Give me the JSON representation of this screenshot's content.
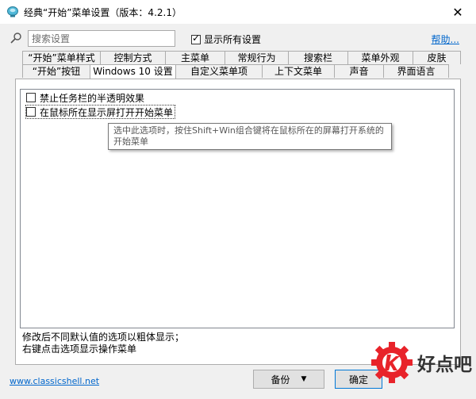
{
  "window": {
    "title": "经典“开始”菜单设置（版本：4.2.1）",
    "close_glyph": "✕"
  },
  "toolbar": {
    "search_placeholder": "搜索设置",
    "show_all_label": "显示所有设置",
    "show_all_checked": true,
    "help_label": "帮助..."
  },
  "tabs": {
    "row1": [
      "“开始”菜单样式",
      "控制方式",
      "主菜单",
      "常规行为",
      "搜索栏",
      "菜单外观",
      "皮肤"
    ],
    "row2": [
      "“开始”按钮",
      "Windows 10 设置",
      "自定义菜单项",
      "上下文菜单",
      "声音",
      "界面语言"
    ],
    "active": "Windows 10 设置"
  },
  "options": [
    {
      "label": "禁止任务栏的半透明效果",
      "checked": false
    },
    {
      "label": "在鼠标所在显示屏打开开始菜单",
      "checked": false
    }
  ],
  "tooltip": "选中此选项时，按住Shift+Win组合键将在鼠标所在的屏幕打开系统的开始菜单",
  "notes": {
    "line1": "修改后不同默认值的选项以粗体显示；",
    "line2": "右键点击选项显示操作菜单"
  },
  "footer": {
    "link": "www.classicshell.net",
    "backup_label": "备份",
    "ok_label": "确定"
  },
  "watermark": {
    "text": "好点吧",
    "color": "#e8232a"
  }
}
